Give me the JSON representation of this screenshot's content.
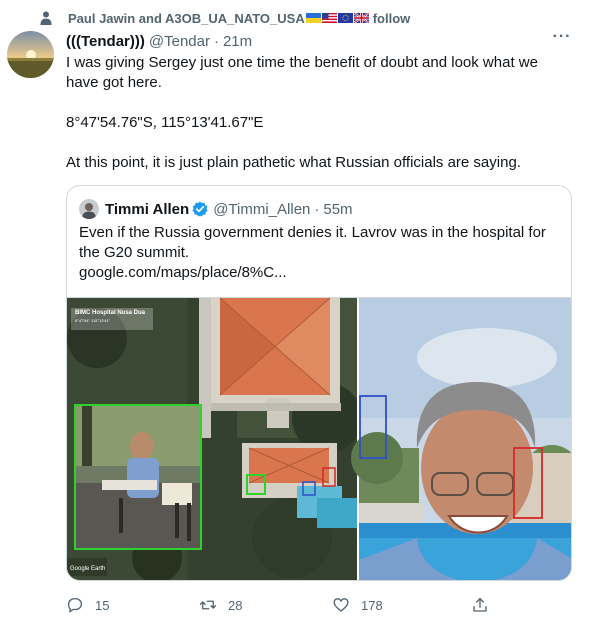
{
  "social_context": {
    "text": "Paul Jawin and A3OB_UA_NATO_USA",
    "follow_label": "follow",
    "icon": "person-icon",
    "flags": [
      "ukraine-flag",
      "us-flag",
      "eu-flag",
      "uk-flag"
    ]
  },
  "tweet": {
    "display_name": "(((Tendar)))",
    "handle": "@Tendar",
    "separator": "·",
    "time": "21m",
    "more_icon": "more-dots-icon",
    "more_label": "···",
    "paragraphs": [
      "I was giving Sergey just one time the benefit of doubt and look what we have got here.",
      "8°47'54.76\"S, 115°13'41.67\"E",
      "At this point, it is just plain pathetic what Russian officials are saying."
    ]
  },
  "quote": {
    "display_name": "Timmi Allen",
    "verified_icon": "verified-badge-icon",
    "handle": "@Timmi_Allen",
    "separator": "·",
    "time": "55m",
    "text": "Even if the Russia government denies it. Lavrov was in the hospital for the G20 summit.",
    "link": "google.com/maps/place/8%C...",
    "media": {
      "map_label": "BIMC Hospital Nusa Dua",
      "map_sublabel": "8°47'54\" 115°13'41\"",
      "watermark": "Google Earth",
      "highlight_colors": {
        "green": "#2fd12f",
        "blue": "#2d50c8",
        "red": "#d62828"
      }
    }
  },
  "actions": {
    "reply": {
      "icon": "reply-icon",
      "count": "15"
    },
    "retweet": {
      "icon": "retweet-icon",
      "count": "28"
    },
    "like": {
      "icon": "heart-icon",
      "count": "178"
    },
    "share": {
      "icon": "share-icon"
    }
  },
  "colors": {
    "text": "#0f1419",
    "secondary": "#536471",
    "border": "#cfd9de",
    "verified": "#1d9bf0"
  }
}
